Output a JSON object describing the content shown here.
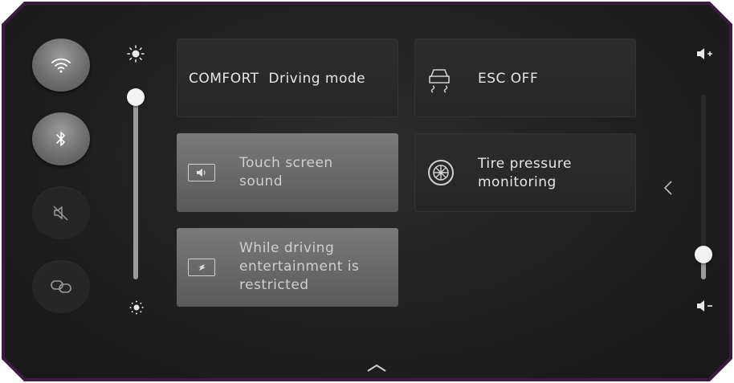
{
  "quick_toggles": [
    {
      "name": "wifi",
      "icon": "wifi-icon",
      "state": "on"
    },
    {
      "name": "bluetooth",
      "icon": "bluetooth-icon",
      "state": "on"
    },
    {
      "name": "mute",
      "icon": "mute-icon",
      "state": "off"
    },
    {
      "name": "link",
      "icon": "link-icon",
      "state": "off"
    }
  ],
  "brightness": {
    "icon_top": "brightness-high-icon",
    "icon_bottom": "brightness-low-icon",
    "level": 0.88
  },
  "tiles": {
    "driving_mode": {
      "mode": "COMFORT",
      "label": "Driving mode"
    },
    "esc": {
      "icon": "esc-icon",
      "label": "ESC OFF"
    },
    "touch_sound": {
      "icon": "speaker-icon",
      "line1": "Touch screen",
      "line2": "sound"
    },
    "tire_pressure": {
      "icon": "tire-icon",
      "line1": "Tire pressure",
      "line2": "monitoring"
    },
    "entertainment": {
      "icon": "screen-blocked-icon",
      "line1": "While driving",
      "line2": "entertainment is",
      "line3": "restricted"
    }
  },
  "volume": {
    "icon_up": "volume-up-icon",
    "icon_down": "volume-down-icon",
    "level": 0.1
  },
  "nav": {
    "expand_right": "chevron-left-icon",
    "expand_up": "chevron-up-icon"
  },
  "colors": {
    "bezel": "#3a1a3f",
    "screen": "#1e1e1e",
    "tile_active": "#6a6a6a",
    "tile_inactive": "#2a2a2a"
  }
}
